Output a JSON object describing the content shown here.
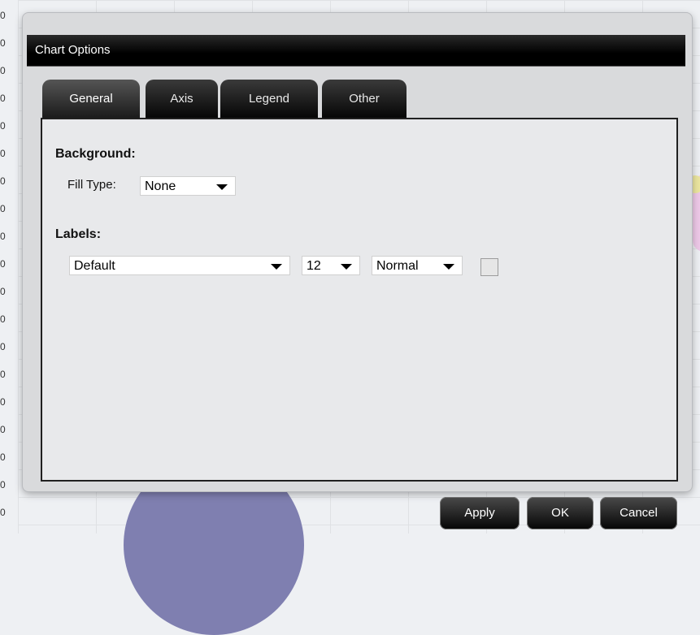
{
  "background_chart": {
    "y_tick_labels": [
      "0",
      "0",
      "0",
      "0",
      "0",
      "0",
      "0",
      "0",
      "0",
      "0",
      "0",
      "0",
      "0",
      "0",
      "0",
      "0",
      "0",
      "0",
      "0"
    ]
  },
  "dialog": {
    "title": "Chart Options",
    "tabs": [
      {
        "label": "General",
        "active": true
      },
      {
        "label": "Axis",
        "active": false
      },
      {
        "label": "Legend",
        "active": false
      },
      {
        "label": "Other",
        "active": false
      }
    ],
    "general": {
      "background_heading": "Background:",
      "fill_type_label": "Fill Type:",
      "fill_type_value": "None",
      "labels_heading": "Labels:",
      "label_font": "Default",
      "label_size": "12",
      "label_style": "Normal",
      "label_color": "#e6e6e6"
    },
    "buttons": {
      "apply": "Apply",
      "ok": "OK",
      "cancel": "Cancel"
    }
  },
  "colors": {
    "titlebar": "#000000",
    "panel_border": "#202020",
    "button": "#111111"
  }
}
